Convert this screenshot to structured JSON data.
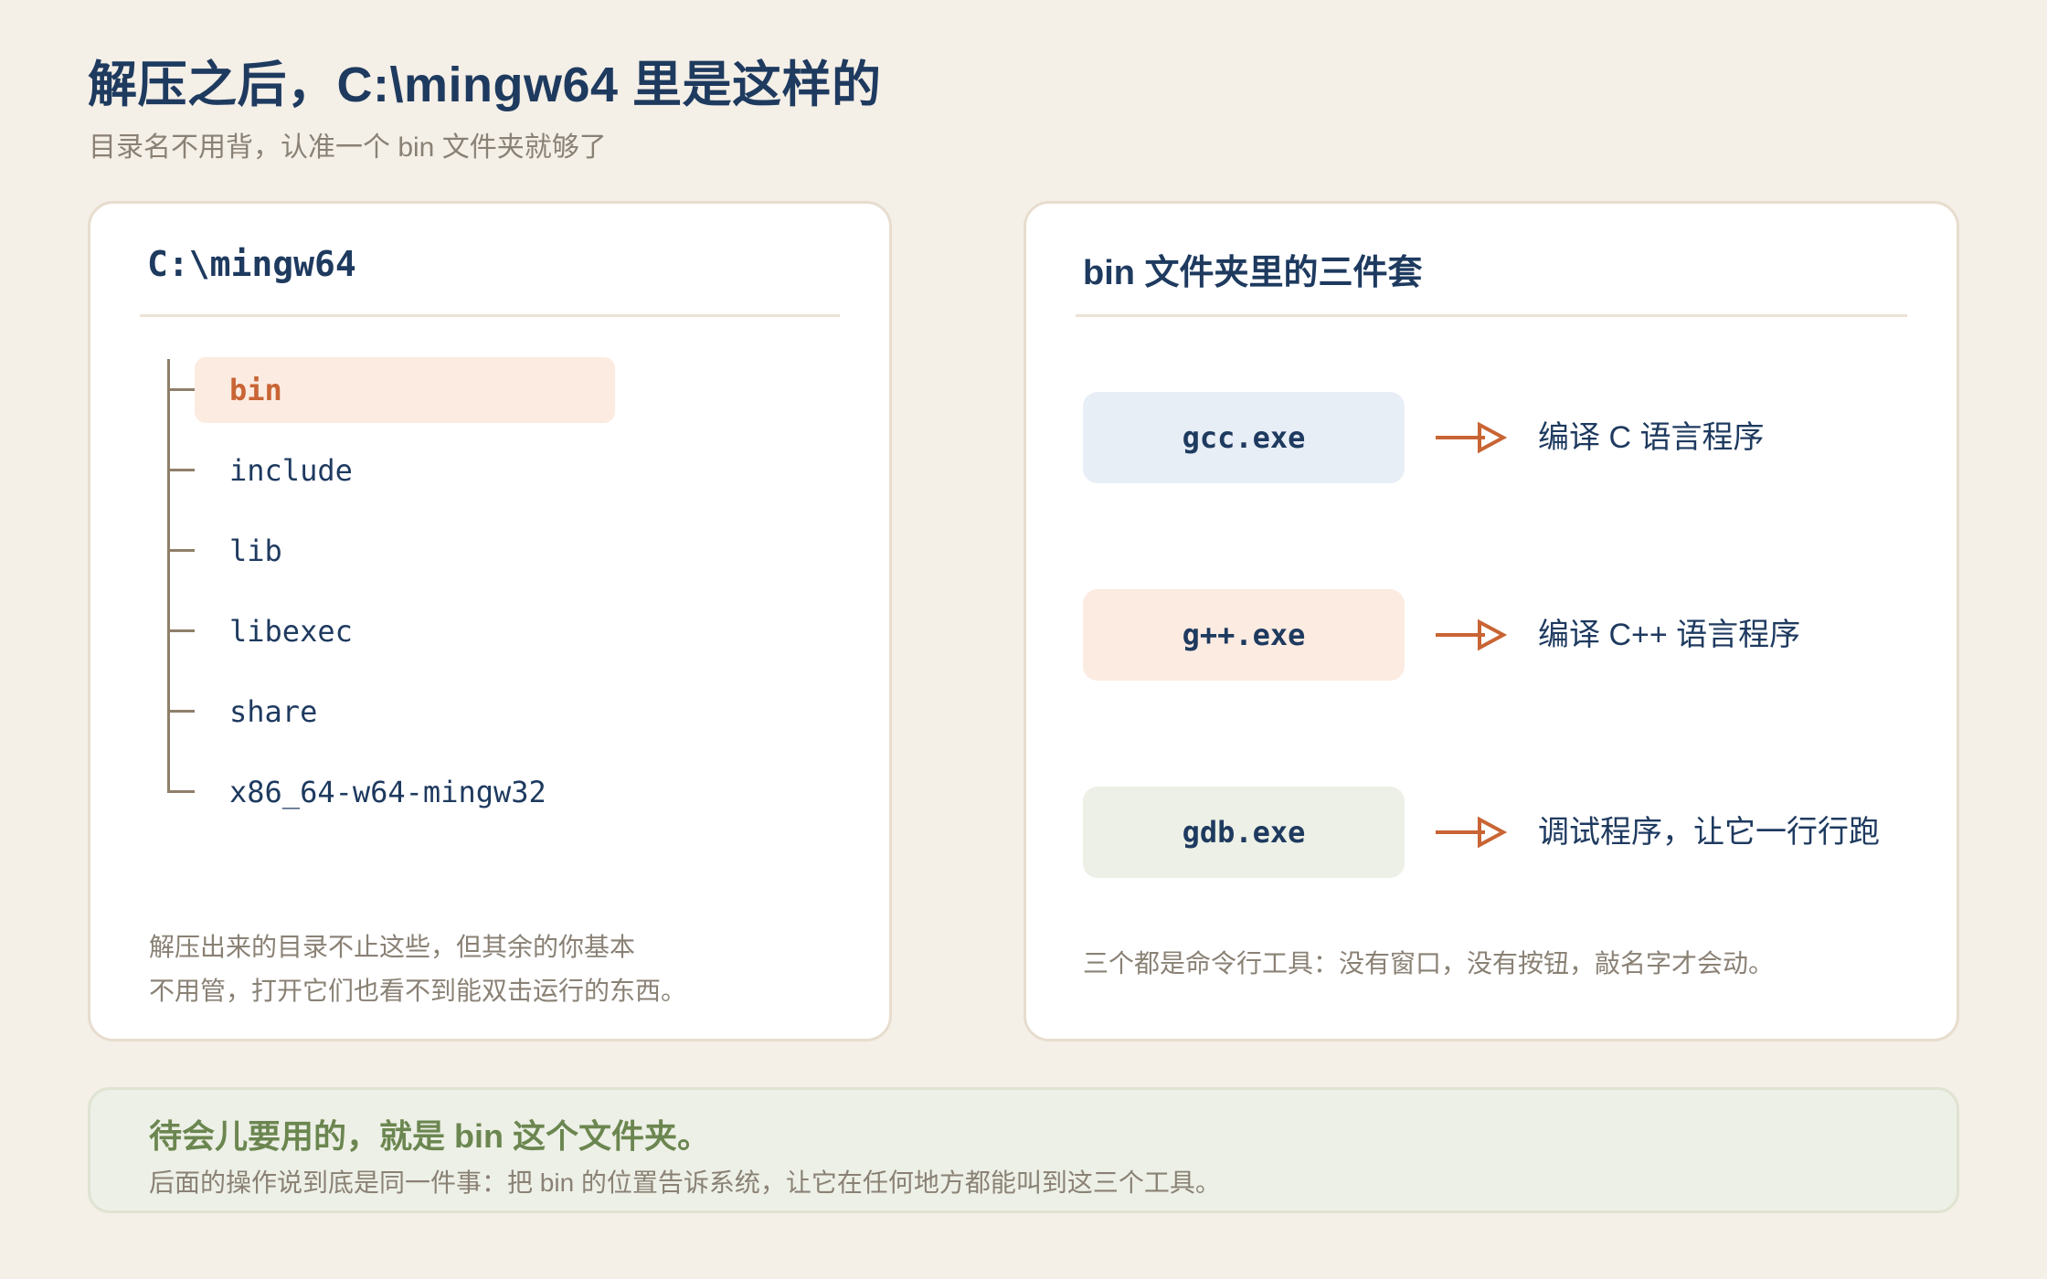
{
  "header": {
    "title": "解压之后，C:\\mingw64 里是这样的",
    "subtitle": "目录名不用背，认准一个 bin 文件夹就够了"
  },
  "left_card": {
    "title": "C:\\mingw64",
    "folders": [
      {
        "label": "bin",
        "highlighted": true
      },
      {
        "label": "include",
        "highlighted": false
      },
      {
        "label": "lib",
        "highlighted": false
      },
      {
        "label": "libexec",
        "highlighted": false
      },
      {
        "label": "share",
        "highlighted": false
      },
      {
        "label": "x86_64-w64-mingw32",
        "highlighted": false
      }
    ],
    "note_line1": "解压出来的目录不止这些，但其余的你基本",
    "note_line2": "不用管，打开它们也看不到能双击运行的东西。"
  },
  "right_card": {
    "title": "bin 文件夹里的三件套",
    "tools": [
      {
        "name": "gcc.exe",
        "description": "编译 C 语言程序",
        "color": "#e8eef6"
      },
      {
        "name": "g++.exe",
        "description": "编译 C++ 语言程序",
        "color": "#fcebe1"
      },
      {
        "name": "gdb.exe",
        "description": "调试程序，让它一行行跑",
        "color": "#edf0e6"
      }
    ],
    "note": "三个都是命令行工具：没有窗口，没有按钮，敲名字才会动。"
  },
  "banner": {
    "title": "待会儿要用的，就是 bin 这个文件夹。",
    "text": "后面的操作说到底是同一件事：把 bin 的位置告诉系统，让它在任何地方都能叫到这三个工具。"
  },
  "colors": {
    "accent": "#c96434",
    "heading": "#1e3a5f",
    "muted": "#8a8175",
    "banner_green": "#6b8650",
    "background": "#f4efe7"
  }
}
